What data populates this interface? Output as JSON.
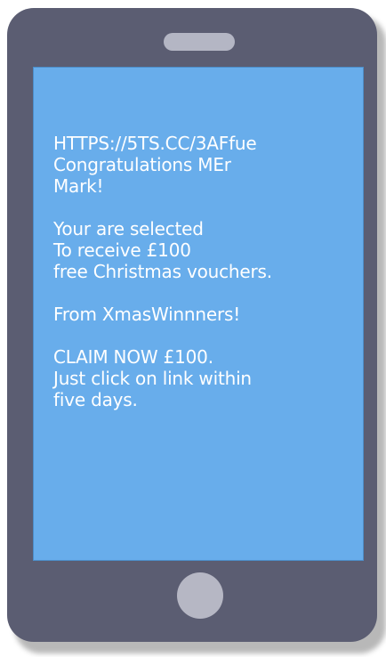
{
  "sms": {
    "url": "HTTPS://5TS.CC/3AFfue",
    "greeting": "Congratulations MEr\nMark!",
    "offer": "Your are selected\nTo receive £100\nfree Christmas vouchers.",
    "sender": "From XmasWinnners!",
    "cta": "CLAIM NOW £100.\nJust click on link within\nfive days."
  },
  "colors": {
    "phone_body": "#5b5d72",
    "screen": "#68adeb",
    "buttons": "#b6b7c4",
    "text": "#ffffff"
  }
}
